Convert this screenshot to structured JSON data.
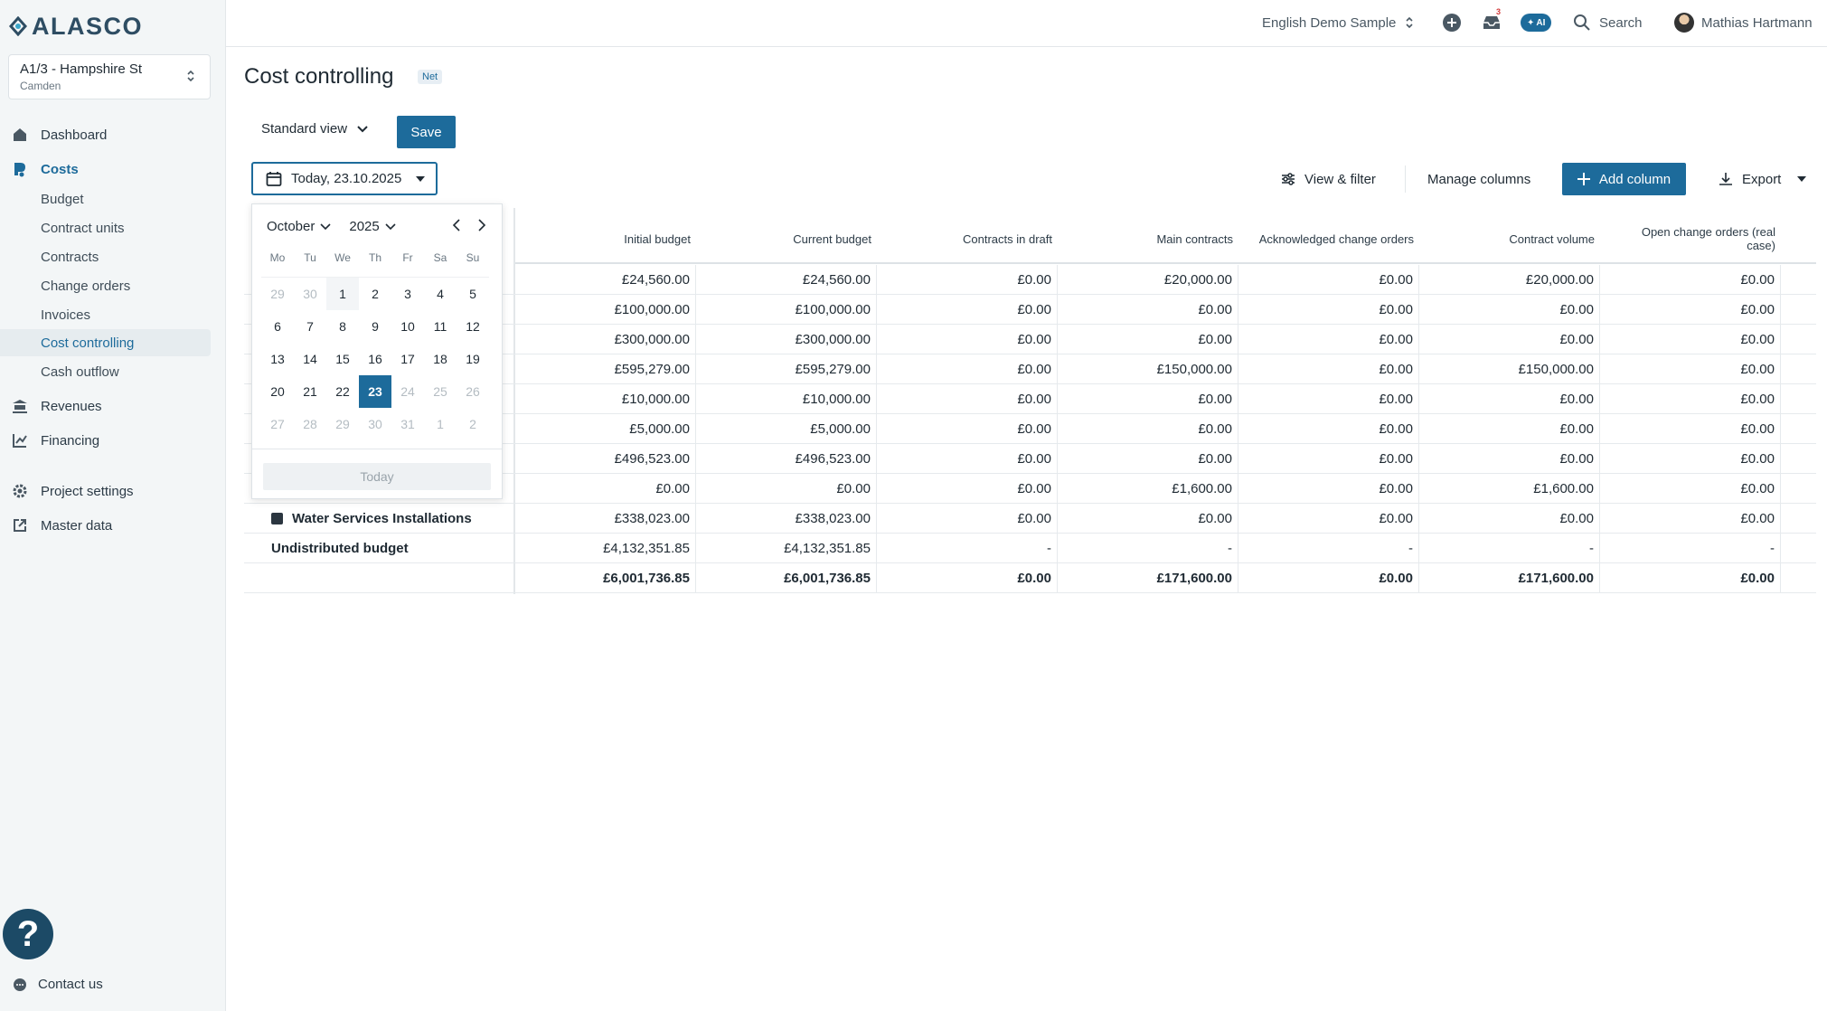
{
  "app": {
    "logo_text": "ALASCO"
  },
  "project": {
    "name": "A1/3 - Hampshire St",
    "sub": "Camden"
  },
  "nav": {
    "dashboard": "Dashboard",
    "costs": "Costs",
    "costs_sub": [
      "Budget",
      "Contract units",
      "Contracts",
      "Change orders",
      "Invoices",
      "Cost controlling",
      "Cash outflow"
    ],
    "revenues": "Revenues",
    "financing": "Financing",
    "project_settings": "Project settings",
    "master_data": "Master data",
    "contact": "Contact us"
  },
  "topbar": {
    "workspace": "English Demo Sample",
    "notification_count": "3",
    "ai_label": "AI",
    "search": "Search",
    "user": "Mathias Hartmann"
  },
  "page": {
    "title": "Cost controlling",
    "badge": "Net",
    "view": "Standard view",
    "save": "Save",
    "date": "Today, 23.10.2025"
  },
  "toolbar": {
    "view_filter": "View & filter",
    "manage_columns": "Manage columns",
    "add_column": "Add column",
    "export": "Export"
  },
  "table": {
    "columns": [
      "Initial budget",
      "Current budget",
      "Contracts in draft",
      "Main contracts",
      "Acknowledged change orders",
      "Contract volume",
      "Open change orders (real case)"
    ],
    "rows": [
      {
        "label": "",
        "values": [
          "£24,560.00",
          "£24,560.00",
          "£0.00",
          "£20,000.00",
          "£0.00",
          "£20,000.00",
          "£0.00"
        ]
      },
      {
        "label": "",
        "values": [
          "£100,000.00",
          "£100,000.00",
          "£0.00",
          "£0.00",
          "£0.00",
          "£0.00",
          "£0.00"
        ]
      },
      {
        "label": "",
        "values": [
          "£300,000.00",
          "£300,000.00",
          "£0.00",
          "£0.00",
          "£0.00",
          "£0.00",
          "£0.00"
        ]
      },
      {
        "label": "",
        "values": [
          "£595,279.00",
          "£595,279.00",
          "£0.00",
          "£150,000.00",
          "£0.00",
          "£150,000.00",
          "£0.00"
        ]
      },
      {
        "label": "",
        "values": [
          "£10,000.00",
          "£10,000.00",
          "£0.00",
          "£0.00",
          "£0.00",
          "£0.00",
          "£0.00"
        ]
      },
      {
        "label": "",
        "values": [
          "£5,000.00",
          "£5,000.00",
          "£0.00",
          "£0.00",
          "£0.00",
          "£0.00",
          "£0.00"
        ]
      },
      {
        "label": "",
        "values": [
          "£496,523.00",
          "£496,523.00",
          "£0.00",
          "£0.00",
          "£0.00",
          "£0.00",
          "£0.00"
        ]
      },
      {
        "label": "",
        "values": [
          "£0.00",
          "£0.00",
          "£0.00",
          "£1,600.00",
          "£0.00",
          "£1,600.00",
          "£0.00"
        ]
      },
      {
        "label": "Water Services Installations",
        "values": [
          "£338,023.00",
          "£338,023.00",
          "£0.00",
          "£0.00",
          "£0.00",
          "£0.00",
          "£0.00"
        ]
      },
      {
        "label": "Undistributed budget",
        "values": [
          "£4,132,351.85",
          "£4,132,351.85",
          "-",
          "-",
          "-",
          "-",
          "-"
        ]
      }
    ],
    "total": [
      "£6,001,736.85",
      "£6,001,736.85",
      "£0.00",
      "£171,600.00",
      "£0.00",
      "£171,600.00",
      "£0.00"
    ]
  },
  "datepicker": {
    "month": "October",
    "year": "2025",
    "weekdays": [
      "Mo",
      "Tu",
      "We",
      "Th",
      "Fr",
      "Sa",
      "Su"
    ],
    "weeks": [
      [
        "29",
        "30",
        "1",
        "2",
        "3",
        "4",
        "5"
      ],
      [
        "6",
        "7",
        "8",
        "9",
        "10",
        "11",
        "12"
      ],
      [
        "13",
        "14",
        "15",
        "16",
        "17",
        "18",
        "19"
      ],
      [
        "20",
        "21",
        "22",
        "23",
        "24",
        "25",
        "26"
      ],
      [
        "27",
        "28",
        "29",
        "30",
        "31",
        "1",
        "2"
      ]
    ],
    "selected": "23",
    "today_button": "Today"
  },
  "colors": {
    "accent": "#1d6b9b",
    "sidebar_bg": "#f3f6f7",
    "help": "#1c4a66"
  }
}
